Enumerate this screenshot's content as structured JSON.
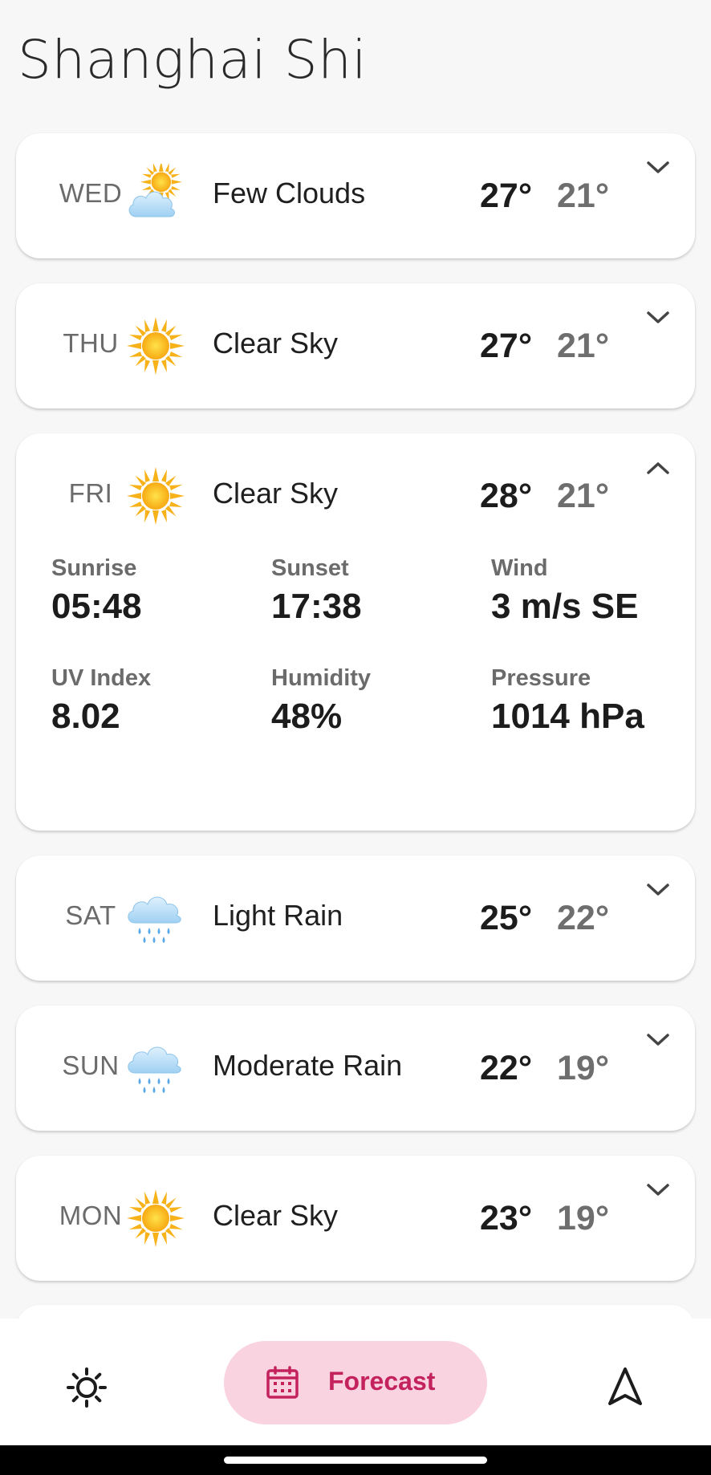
{
  "location": {
    "title": "Shanghai Shi"
  },
  "days": [
    {
      "day": "WED",
      "icon": "sun-behind-cloud-icon",
      "condition": "Few Clouds",
      "high": "27°",
      "low": "21°",
      "expanded": false
    },
    {
      "day": "THU",
      "icon": "sun-icon",
      "condition": "Clear Sky",
      "high": "27°",
      "low": "21°",
      "expanded": false
    },
    {
      "day": "FRI",
      "icon": "sun-icon",
      "condition": "Clear Sky",
      "high": "28°",
      "low": "21°",
      "expanded": true,
      "details": {
        "sunrise": {
          "label": "Sunrise",
          "value": "05:48"
        },
        "sunset": {
          "label": "Sunset",
          "value": "17:38"
        },
        "wind": {
          "label": "Wind",
          "value": "3 m/s SE"
        },
        "uv": {
          "label": "UV Index",
          "value": "8.02"
        },
        "humidity": {
          "label": "Humidity",
          "value": "48%"
        },
        "pressure": {
          "label": "Pressure",
          "value": "1014 hPa"
        }
      }
    },
    {
      "day": "SAT",
      "icon": "rain-cloud-icon",
      "condition": "Light Rain",
      "high": "25°",
      "low": "22°",
      "expanded": false
    },
    {
      "day": "SUN",
      "icon": "rain-cloud-icon",
      "condition": "Moderate Rain",
      "high": "22°",
      "low": "19°",
      "expanded": false
    },
    {
      "day": "MON",
      "icon": "sun-icon",
      "condition": "Clear Sky",
      "high": "23°",
      "low": "19°",
      "expanded": false
    }
  ],
  "nav": {
    "today_icon": "sun-outline-icon",
    "forecast_label": "Forecast",
    "forecast_icon": "calendar-icon",
    "map_icon": "navigation-arrow-icon"
  },
  "colors": {
    "accent": "#c4225d",
    "accent_bg": "#f9d3df",
    "background": "#f7f7f7"
  }
}
